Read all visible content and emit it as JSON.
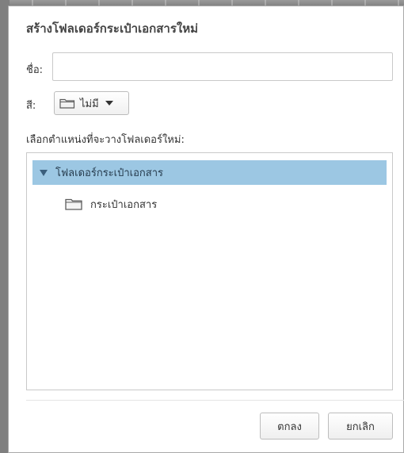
{
  "dialog": {
    "title": "สร้างโฟลเดอร์กระเป๋าเอกสารใหม่",
    "name_label": "ชื่อ:",
    "name_value": "",
    "color_label": "สี:",
    "color_selected": "ไม่มี",
    "location_label": "เลือกตำแหน่งที่จะวางโฟลเดอร์ใหม่:",
    "tree": {
      "root_label": "โฟลเดอร์กระเป๋าเอกสาร",
      "children": [
        {
          "label": "กระเป๋าเอกสาร",
          "icon": "folder-icon"
        }
      ]
    },
    "buttons": {
      "ok_label": "ตกลง",
      "cancel_label": "ยกเลิก"
    }
  },
  "colors": {
    "selected_row": "#9cc7e3",
    "dialog_bg": "#ffffff",
    "border": "#c9c9c9"
  }
}
